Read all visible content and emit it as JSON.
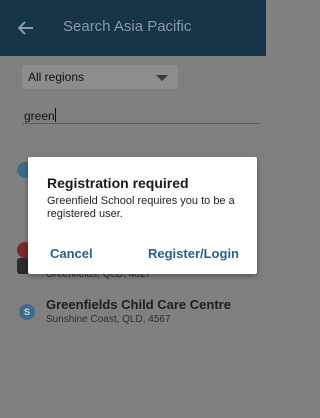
{
  "appbar": {
    "title": "Search Asia Pacific",
    "back_icon": "arrow-left-icon",
    "background": "#163447"
  },
  "filters": {
    "region_selected": "All regions",
    "search_value": "green"
  },
  "results": [
    {
      "name": "",
      "location": ""
    },
    {
      "name": "",
      "location": ""
    },
    {
      "name": "",
      "location": "Greenfields, QLD, 4027"
    },
    {
      "name": "Greenfields Child Care Centre",
      "location": "Sunshine Coast, QLD, 4567"
    }
  ],
  "dialog": {
    "title": "Registration required",
    "message": "Greenfield School requires you to be a registered user.",
    "cancel_label": "Cancel",
    "register_label": "Register/Login",
    "accent": "#2a5f8c"
  }
}
